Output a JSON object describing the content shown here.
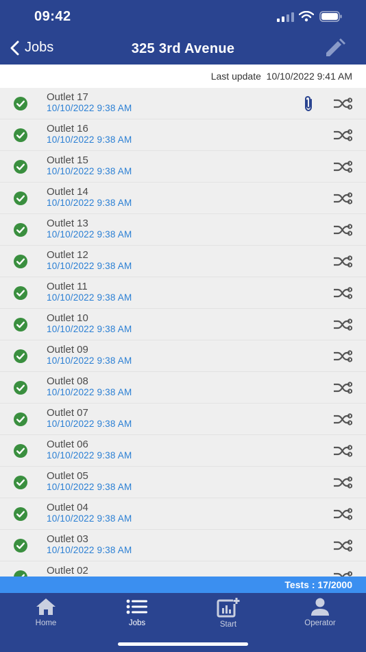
{
  "status": {
    "time": "09:42"
  },
  "header": {
    "back_label": "Jobs",
    "title": "325 3rd Avenue"
  },
  "last_update": "Last update  10/10/2022 9:41 AM",
  "colors": {
    "nav_bg": "#2a4490",
    "accent": "#3b8ff0",
    "date_text": "#2a7fd4",
    "check": "#3a8f3f"
  },
  "outlets": [
    {
      "name": "Outlet 17",
      "date": "10/10/2022 9:38 AM",
      "has_attachment": true
    },
    {
      "name": "Outlet 16",
      "date": "10/10/2022 9:38 AM",
      "has_attachment": false
    },
    {
      "name": "Outlet 15",
      "date": "10/10/2022 9:38 AM",
      "has_attachment": false
    },
    {
      "name": "Outlet 14",
      "date": "10/10/2022 9:38 AM",
      "has_attachment": false
    },
    {
      "name": "Outlet 13",
      "date": "10/10/2022 9:38 AM",
      "has_attachment": false
    },
    {
      "name": "Outlet 12",
      "date": "10/10/2022 9:38 AM",
      "has_attachment": false
    },
    {
      "name": "Outlet 11",
      "date": "10/10/2022 9:38 AM",
      "has_attachment": false
    },
    {
      "name": "Outlet 10",
      "date": "10/10/2022 9:38 AM",
      "has_attachment": false
    },
    {
      "name": "Outlet 09",
      "date": "10/10/2022 9:38 AM",
      "has_attachment": false
    },
    {
      "name": "Outlet 08",
      "date": "10/10/2022 9:38 AM",
      "has_attachment": false
    },
    {
      "name": "Outlet 07",
      "date": "10/10/2022 9:38 AM",
      "has_attachment": false
    },
    {
      "name": "Outlet 06",
      "date": "10/10/2022 9:38 AM",
      "has_attachment": false
    },
    {
      "name": "Outlet 05",
      "date": "10/10/2022 9:38 AM",
      "has_attachment": false
    },
    {
      "name": "Outlet 04",
      "date": "10/10/2022 9:38 AM",
      "has_attachment": false
    },
    {
      "name": "Outlet 03",
      "date": "10/10/2022 9:38 AM",
      "has_attachment": false
    },
    {
      "name": "Outlet 02",
      "date": "",
      "has_attachment": false
    }
  ],
  "tests_label": "Tests : 17/2000",
  "tabs": [
    {
      "label": "Home",
      "icon": "home-icon"
    },
    {
      "label": "Jobs",
      "icon": "list-icon"
    },
    {
      "label": "Start",
      "icon": "add-chart-icon"
    },
    {
      "label": "Operator",
      "icon": "person-icon"
    }
  ]
}
